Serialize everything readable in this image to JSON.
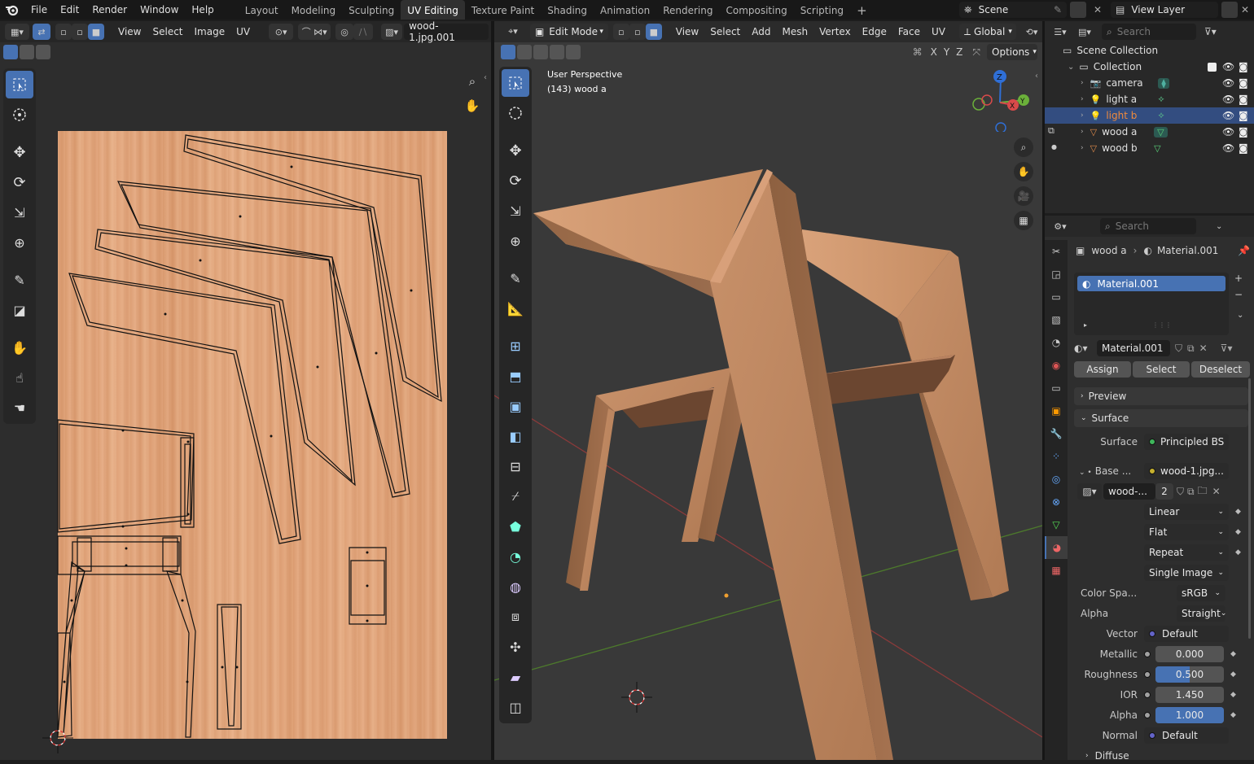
{
  "app": {
    "menu": [
      "File",
      "Edit",
      "Render",
      "Window",
      "Help"
    ],
    "workspaces": [
      "Layout",
      "Modeling",
      "Sculpting",
      "UV Editing",
      "Texture Paint",
      "Shading",
      "Animation",
      "Rendering",
      "Compositing",
      "Scripting"
    ],
    "active_workspace": "UV Editing",
    "add_workspace": "+",
    "scene": "Scene",
    "view_layer": "View Layer"
  },
  "uv_editor": {
    "menus": [
      "View",
      "Select",
      "Image",
      "UV"
    ],
    "image_name": "wood-1.jpg.001"
  },
  "viewport": {
    "mode": "Edit Mode",
    "menus": [
      "View",
      "Select",
      "Add",
      "Mesh",
      "Vertex",
      "Edge",
      "Face",
      "UV"
    ],
    "orientation": "Global",
    "options_label": "Options",
    "axis_x": "X",
    "axis_y": "Y",
    "axis_z": "Z",
    "overlay_title": "User Perspective",
    "overlay_object": "(143) wood a",
    "gizmo": {
      "x": "X",
      "y": "Y",
      "z": "Z"
    }
  },
  "outliner": {
    "search_placeholder": "Search",
    "scene_collection": "Scene Collection",
    "collection": "Collection",
    "items": [
      {
        "name": "camera",
        "selected": false
      },
      {
        "name": "light a",
        "selected": false
      },
      {
        "name": "light b",
        "selected": true
      },
      {
        "name": "wood a",
        "selected": false
      },
      {
        "name": "wood b",
        "selected": false
      }
    ]
  },
  "properties": {
    "search_placeholder": "Search",
    "breadcrumb_object": "wood a",
    "breadcrumb_material": "Material.001",
    "slot": "Material.001",
    "material_name": "Material.001",
    "assign": "Assign",
    "select": "Select",
    "deselect": "Deselect",
    "preview": "Preview",
    "surface_panel": "Surface",
    "surface_label": "Surface",
    "surface_value": "Principled BS...",
    "base_label": "Base ...",
    "base_value": "wood-1.jpg....",
    "image_short": "wood-...",
    "image_users": "2",
    "interpolation": "Linear",
    "projection": "Flat",
    "extension": "Repeat",
    "source": "Single Image",
    "color_space_label": "Color Spa...",
    "color_space": "sRGB",
    "alpha_label": "Alpha",
    "alpha_mode": "Straight",
    "vector_label": "Vector",
    "vector_value": "Default",
    "metallic_label": "Metallic",
    "metallic": "0.000",
    "metallic_fill": 0.0,
    "roughness_label": "Roughness",
    "roughness": "0.500",
    "roughness_fill": 0.5,
    "ior_label": "IOR",
    "ior": "1.450",
    "alpha_value_label": "Alpha",
    "alpha_value": "1.000",
    "alpha_fill": 1.0,
    "normal_label": "Normal",
    "normal_value": "Default",
    "diffuse": "Diffuse"
  },
  "colors": {
    "accent": "#4772b3",
    "selected_text": "#f08a3c",
    "wood_light": "#e0a57b",
    "wood_dark": "#9a6b4a"
  }
}
